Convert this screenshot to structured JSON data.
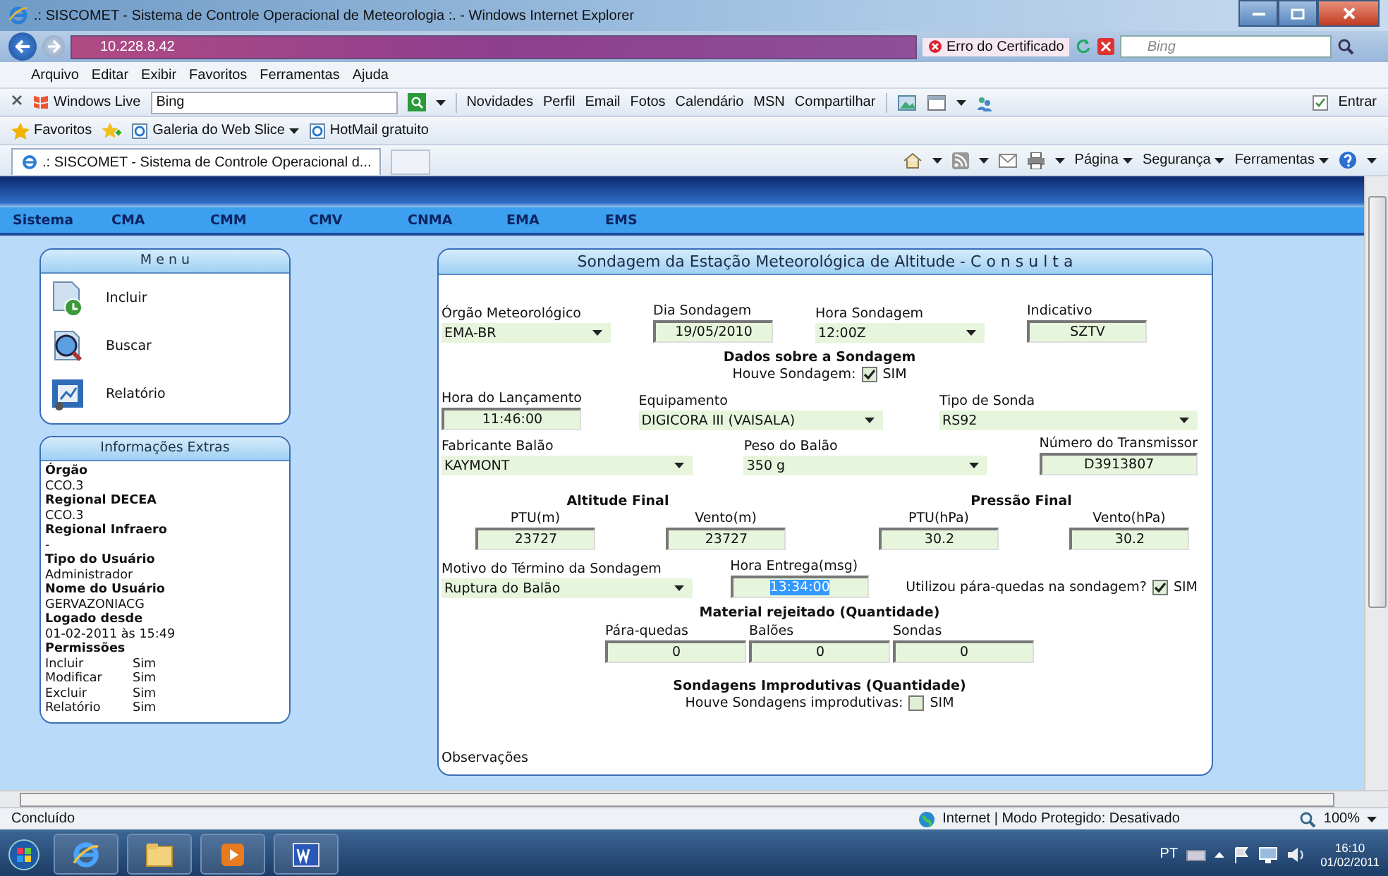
{
  "window": {
    "title": ".: SISCOMET - Sistema de Controle Operacional de Meteorologia :. - Windows Internet Explorer"
  },
  "address_bar": {
    "url": "10.228.8.42",
    "certificate_error": "Erro do Certificado",
    "search_placeholder": "Bing"
  },
  "menu_bar": [
    "Arquivo",
    "Editar",
    "Exibir",
    "Favoritos",
    "Ferramentas",
    "Ajuda"
  ],
  "live_toolbar": {
    "brand": "Windows Live",
    "search_value": "Bing",
    "links": [
      "Novidades",
      "Perfil",
      "Email",
      "Fotos",
      "Calendário",
      "MSN",
      "Compartilhar"
    ],
    "sign_in": "Entrar"
  },
  "favorites_bar": {
    "label": "Favoritos",
    "items": [
      {
        "label": "Galeria do Web Slice",
        "dropdown": true
      },
      {
        "label": "HotMail gratuito",
        "dropdown": false
      }
    ]
  },
  "tabs": [
    {
      "label": ".: SISCOMET - Sistema de Controle Operacional d...",
      "selected": true
    }
  ],
  "command_bar": [
    "Página",
    "Segurança",
    "Ferramentas"
  ],
  "site_nav": [
    "Sistema",
    "CMA",
    "CMM",
    "CMV",
    "CNMA",
    "EMA",
    "EMS"
  ],
  "menu_panel": {
    "title": "M e n u",
    "items": [
      {
        "label": "Incluir",
        "kind": "add"
      },
      {
        "label": "Buscar",
        "kind": "search"
      },
      {
        "label": "Relatório",
        "kind": "report"
      }
    ]
  },
  "info_panel": {
    "title": "Informações Extras",
    "fields": [
      {
        "label": "Órgão",
        "value": "CCO.3"
      },
      {
        "label": "Regional DECEA",
        "value": "CCO.3"
      },
      {
        "label": "Regional Infraero",
        "value": "-"
      },
      {
        "label": "Tipo do Usuário",
        "value": "Administrador"
      },
      {
        "label": "Nome do Usuário",
        "value": "GERVAZONIACG"
      },
      {
        "label": "Logado desde",
        "value": "01-02-2011 às 15:49"
      }
    ],
    "permissions": {
      "label": "Permissões",
      "rows": [
        {
          "name": "Incluir",
          "value": "Sim"
        },
        {
          "name": "Modificar",
          "value": "Sim"
        },
        {
          "name": "Excluir",
          "value": "Sim"
        },
        {
          "name": "Relatório",
          "value": "Sim"
        }
      ]
    }
  },
  "form": {
    "title": "Sondagem da Estação Meteorológica de Altitude - C o n s u l t a",
    "blocks": [
      {
        "kind": "fields",
        "fields": [
          {
            "kind": "select",
            "label": "Órgão Meteorológico",
            "value": "EMA-BR",
            "highlighted": false
          },
          {
            "kind": "text",
            "label": "Dia Sondagem",
            "value": "19/05/2010",
            "highlighted": false
          },
          {
            "kind": "select",
            "label": "Hora Sondagem",
            "value": "12:00Z",
            "highlighted": false
          },
          {
            "kind": "text",
            "label": "Indicativo",
            "value": "SZTV",
            "highlighted": false
          }
        ]
      },
      {
        "kind": "heading",
        "text": "Dados sobre a Sondagem"
      },
      {
        "kind": "check",
        "label": "Houve Sondagem:",
        "checked": true,
        "option": "SIM"
      },
      {
        "kind": "fields",
        "fields": [
          {
            "kind": "text",
            "label": "Hora do Lançamento",
            "value": "11:46:00",
            "highlighted": false
          },
          {
            "kind": "select",
            "label": "Equipamento",
            "value": "DIGICORA III (VAISALA)",
            "highlighted": false
          },
          {
            "kind": "select",
            "label": "Tipo de Sonda",
            "value": "RS92",
            "highlighted": false
          }
        ]
      },
      {
        "kind": "fields",
        "fields": [
          {
            "kind": "select",
            "label": "Fabricante Balão",
            "value": "KAYMONT",
            "highlighted": false
          },
          {
            "kind": "select",
            "label": "Peso do Balão",
            "value": "350 g",
            "highlighted": false
          },
          {
            "kind": "text",
            "label": "Número do Transmissor",
            "value": "D3913807",
            "highlighted": false
          }
        ]
      },
      {
        "kind": "groups",
        "groups": [
          {
            "title": "Altitude Final",
            "fields": [
              {
                "kind": "text",
                "label": "PTU(m)",
                "value": "23727",
                "highlighted": false
              },
              {
                "kind": "text",
                "label": "Vento(m)",
                "value": "23727",
                "highlighted": false
              }
            ]
          },
          {
            "title": "Pressão Final",
            "fields": [
              {
                "kind": "text",
                "label": "PTU(hPa)",
                "value": "30.2",
                "highlighted": false
              },
              {
                "kind": "text",
                "label": "Vento(hPa)",
                "value": "30.2",
                "highlighted": false
              }
            ]
          }
        ]
      },
      {
        "kind": "fields",
        "fields": [
          {
            "kind": "select",
            "label": "Motivo do Término da Sondagem",
            "value": "Ruptura do Balão",
            "highlighted": false
          },
          {
            "kind": "text",
            "label": "Hora Entrega(msg)",
            "value": "13:34:00",
            "highlighted": true
          },
          {
            "kind": "check",
            "label": "Utilizou pára-quedas na sondagem?",
            "checked": true,
            "option": "SIM"
          }
        ]
      },
      {
        "kind": "heading",
        "text": "Material rejeitado (Quantidade)"
      },
      {
        "kind": "counts",
        "fields": [
          {
            "kind": "text",
            "label": "Pára-quedas",
            "value": "0",
            "highlighted": false
          },
          {
            "kind": "text",
            "label": "Balões",
            "value": "0",
            "highlighted": false
          },
          {
            "kind": "text",
            "label": "Sondas",
            "value": "0",
            "highlighted": false
          }
        ]
      },
      {
        "kind": "heading",
        "text": "Sondagens Improdutivas (Quantidade)"
      },
      {
        "kind": "check",
        "label": "Houve Sondagens improdutivas:",
        "checked": false,
        "option": "SIM"
      },
      {
        "kind": "label",
        "text": "Observações"
      }
    ]
  },
  "status_bar": {
    "text": "Concluído",
    "zone": "Internet | Modo Protegido: Desativado",
    "zoom": "100%"
  },
  "taskbar": {
    "language": "PT",
    "time": "16:10",
    "date": "01/02/2011"
  }
}
